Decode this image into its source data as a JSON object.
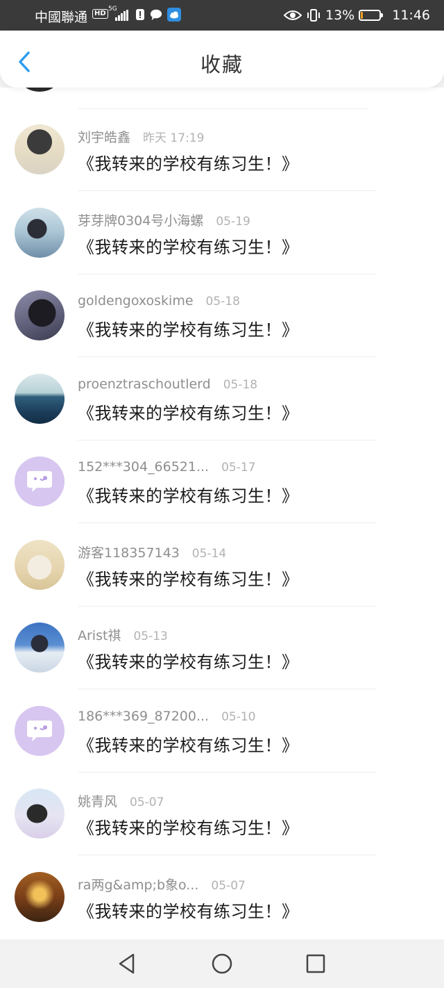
{
  "status_bar": {
    "carrier": "中國聯通",
    "hd_badge": "HD",
    "network": "5G",
    "battery_percent": "13%",
    "battery_level": 0.13,
    "time": "11:46"
  },
  "header": {
    "title": "收藏",
    "back_icon": "chevron-left-icon",
    "accent_color": "#2c9cf0"
  },
  "favorites": [
    {
      "user": "刘宇皓鑫",
      "date": "昨天 17:19",
      "work": "《我转来的学校有练习生！》"
    },
    {
      "user": "芽芽牌0304号小海螺",
      "date": "05-19",
      "work": "《我转来的学校有练习生！》"
    },
    {
      "user": "goldengoxoskime",
      "date": "05-18",
      "work": "《我转来的学校有练习生！》"
    },
    {
      "user": "proenztraschoutlerd",
      "date": "05-18",
      "work": "《我转来的学校有练习生！》"
    },
    {
      "user": "152***304_66521...",
      "date": "05-17",
      "work": "《我转来的学校有练习生！》"
    },
    {
      "user": "游客118357143",
      "date": "05-14",
      "work": "《我转来的学校有练习生！》"
    },
    {
      "user": "Arist祺",
      "date": "05-13",
      "work": "《我转来的学校有练习生！》"
    },
    {
      "user": "186***369_87200...",
      "date": "05-10",
      "work": "《我转来的学校有练习生！》"
    },
    {
      "user": "姚青风",
      "date": "05-07",
      "work": "《我转来的学校有练习生！》"
    },
    {
      "user": "ra两g&amp;b象o...",
      "date": "05-07",
      "work": "《我转来的学校有练习生！》"
    }
  ],
  "nav_bar": {
    "icons": [
      "back-triangle-icon",
      "home-circle-icon",
      "recents-square-icon"
    ]
  }
}
